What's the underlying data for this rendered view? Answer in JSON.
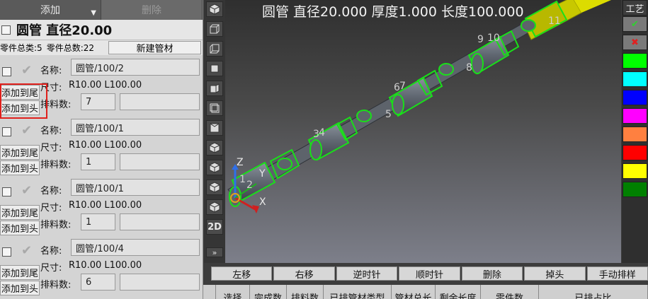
{
  "left": {
    "add_button": "添加",
    "delete_button": "删除",
    "header_title": "圆管 直径20.00",
    "stats": {
      "types": "零件总类:5",
      "total": "零件总数:22"
    },
    "new_tube_button": "新建管材",
    "labels": {
      "name": "名称:",
      "size": "尺寸:",
      "count": "排料数:"
    },
    "add_tail": "添加到尾",
    "add_head": "添加到头",
    "parts": [
      {
        "name": "圆管/100/2",
        "size": "R10.00 L100.00",
        "count": "7"
      },
      {
        "name": "圆管/100/1",
        "size": "R10.00 L100.00",
        "count": "1"
      },
      {
        "name": "圆管/100/1",
        "size": "R10.00 L100.00",
        "count": "1"
      },
      {
        "name": "圆管/100/4",
        "size": "R10.00 L100.00",
        "count": "6"
      }
    ]
  },
  "viewport": {
    "title": "圆管 直径20.000 厚度1.000 长度100.000",
    "axes": {
      "z": "Z",
      "y": "Y",
      "x": "X"
    },
    "part_numbers": [
      "1",
      "2",
      "3",
      "4",
      "5",
      "6",
      "7",
      "8",
      "9",
      "10",
      "11"
    ]
  },
  "toolbar": {
    "view_2d": "2D",
    "collapse": "»"
  },
  "right": {
    "craft_button": "工艺",
    "confirm_icon": "✔",
    "cancel_icon": "✖",
    "colors": [
      "#00ff00",
      "#00ffff",
      "#0000ff",
      "#ff00ff",
      "#ff8040",
      "#ff0000",
      "#ffff00",
      "#008000"
    ]
  },
  "actions": [
    "左移",
    "右移",
    "逆时针",
    "顺时针",
    "删除",
    "掉头",
    "手动排样"
  ],
  "columns": [
    "",
    "选择",
    "完成数",
    "排料数",
    "已排管材类型",
    "管材总长",
    "剩余长度",
    "零件数",
    "已排占比"
  ]
}
